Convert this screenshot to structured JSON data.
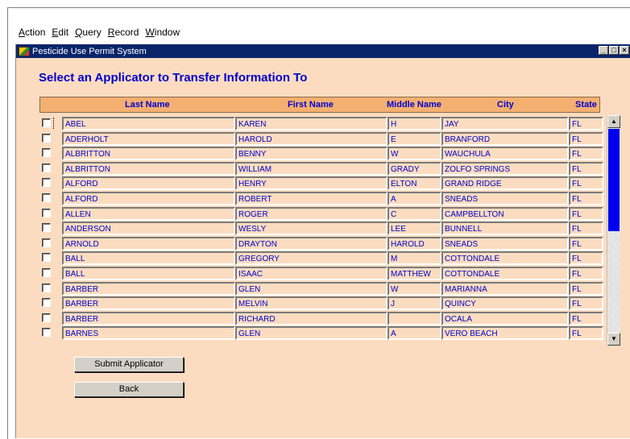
{
  "menu": [
    {
      "label": "Action",
      "u": "A",
      "rest": "ction"
    },
    {
      "label": "Edit",
      "u": "E",
      "rest": "dit"
    },
    {
      "label": "Query",
      "u": "Q",
      "rest": "uery"
    },
    {
      "label": "Record",
      "u": "R",
      "rest": "ecord"
    },
    {
      "label": "Window",
      "u": "W",
      "rest": "indow"
    }
  ],
  "window": {
    "title": "Pesticide Use Permit System"
  },
  "heading": "Select an Applicator to Transfer Information To",
  "columns": {
    "last": "Last Name",
    "first": "First Name",
    "middle": "Middle Name",
    "city": "City",
    "state": "State"
  },
  "rows": [
    {
      "last": "ABEL",
      "first": "KAREN",
      "middle": "H",
      "city": "JAY",
      "state": "FL"
    },
    {
      "last": "ADERHOLT",
      "first": "HAROLD",
      "middle": "E",
      "city": "BRANFORD",
      "state": "FL"
    },
    {
      "last": "ALBRITTON",
      "first": "BENNY",
      "middle": "W",
      "city": "WAUCHULA",
      "state": "FL"
    },
    {
      "last": "ALBRITTON",
      "first": "WILLIAM",
      "middle": "GRADY",
      "city": "ZOLFO SPRINGS",
      "state": "FL"
    },
    {
      "last": "ALFORD",
      "first": "HENRY",
      "middle": "ELTON",
      "city": "GRAND RIDGE",
      "state": "FL"
    },
    {
      "last": "ALFORD",
      "first": "ROBERT",
      "middle": "A",
      "city": "SNEADS",
      "state": "FL"
    },
    {
      "last": "ALLEN",
      "first": "ROGER",
      "middle": "C",
      "city": "CAMPBELLTON",
      "state": "FL"
    },
    {
      "last": "ANDERSON",
      "first": "WESLY",
      "middle": "LEE",
      "city": "BUNNELL",
      "state": "FL"
    },
    {
      "last": "ARNOLD",
      "first": "DRAYTON",
      "middle": "HAROLD",
      "city": "SNEADS",
      "state": "FL"
    },
    {
      "last": "BALL",
      "first": "GREGORY",
      "middle": "M",
      "city": "COTTONDALE",
      "state": "FL"
    },
    {
      "last": "BALL",
      "first": "ISAAC",
      "middle": "MATTHEW",
      "city": "COTTONDALE",
      "state": "FL"
    },
    {
      "last": "BARBER",
      "first": "GLEN",
      "middle": "W",
      "city": "MARIANNA",
      "state": "FL"
    },
    {
      "last": "BARBER",
      "first": "MELVIN",
      "middle": "J",
      "city": "QUINCY",
      "state": "FL"
    },
    {
      "last": "BARBER",
      "first": "RICHARD",
      "middle": "",
      "city": "OCALA",
      "state": "FL"
    },
    {
      "last": "BARNES",
      "first": "GLEN",
      "middle": "A",
      "city": "VERO BEACH",
      "state": "FL"
    }
  ],
  "buttons": {
    "submit": "Submit Applicator",
    "back": "Back"
  },
  "scrollbar": {
    "up": "▲",
    "down": "▼"
  },
  "colors": {
    "background": "#fbdcc0",
    "header": "#f4b071",
    "title_bar": "#0a246a",
    "text": "#0000cc"
  }
}
